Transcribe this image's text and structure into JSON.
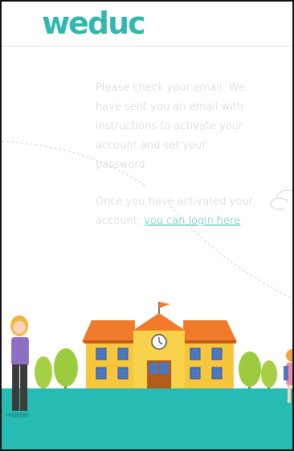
{
  "brand": {
    "logo_text": "weduc",
    "accent_color": "#30b7b1",
    "ground_color": "#26bbb3"
  },
  "message": {
    "check_email_text": "Please check your email. We have sent you an email with instructions to activate your account and set your password.",
    "activated_prefix": "Once you have activated your account, ",
    "login_link_label": "you can login here",
    "suffix": "."
  },
  "illustration": {
    "school_icon": "school-building-icon",
    "clock_icon": "clock-icon",
    "flag_icon": "flag-icon",
    "cloud_icon": "cloud-icon",
    "teacher_icon": "teacher-figure-icon",
    "child_icon": "child-figure-icon",
    "tree_icon": "tree-icon"
  }
}
